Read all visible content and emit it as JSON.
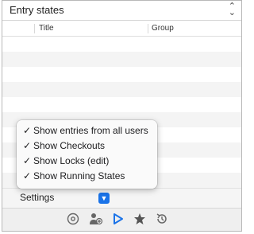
{
  "header": {
    "title": "Entry states"
  },
  "columns": {
    "title": "Title",
    "group": "Group"
  },
  "menu": {
    "check": "✓",
    "items": [
      "Show entries from all users",
      "Show Checkouts",
      "Show Locks (edit)",
      "Show Running States"
    ]
  },
  "footer": {
    "settings_label": "Settings"
  },
  "toolbar": {
    "icons": [
      "settings-gear-icon",
      "user-add-icon",
      "play-icon",
      "star-icon",
      "history-icon"
    ],
    "accent": "#1a73e8"
  }
}
